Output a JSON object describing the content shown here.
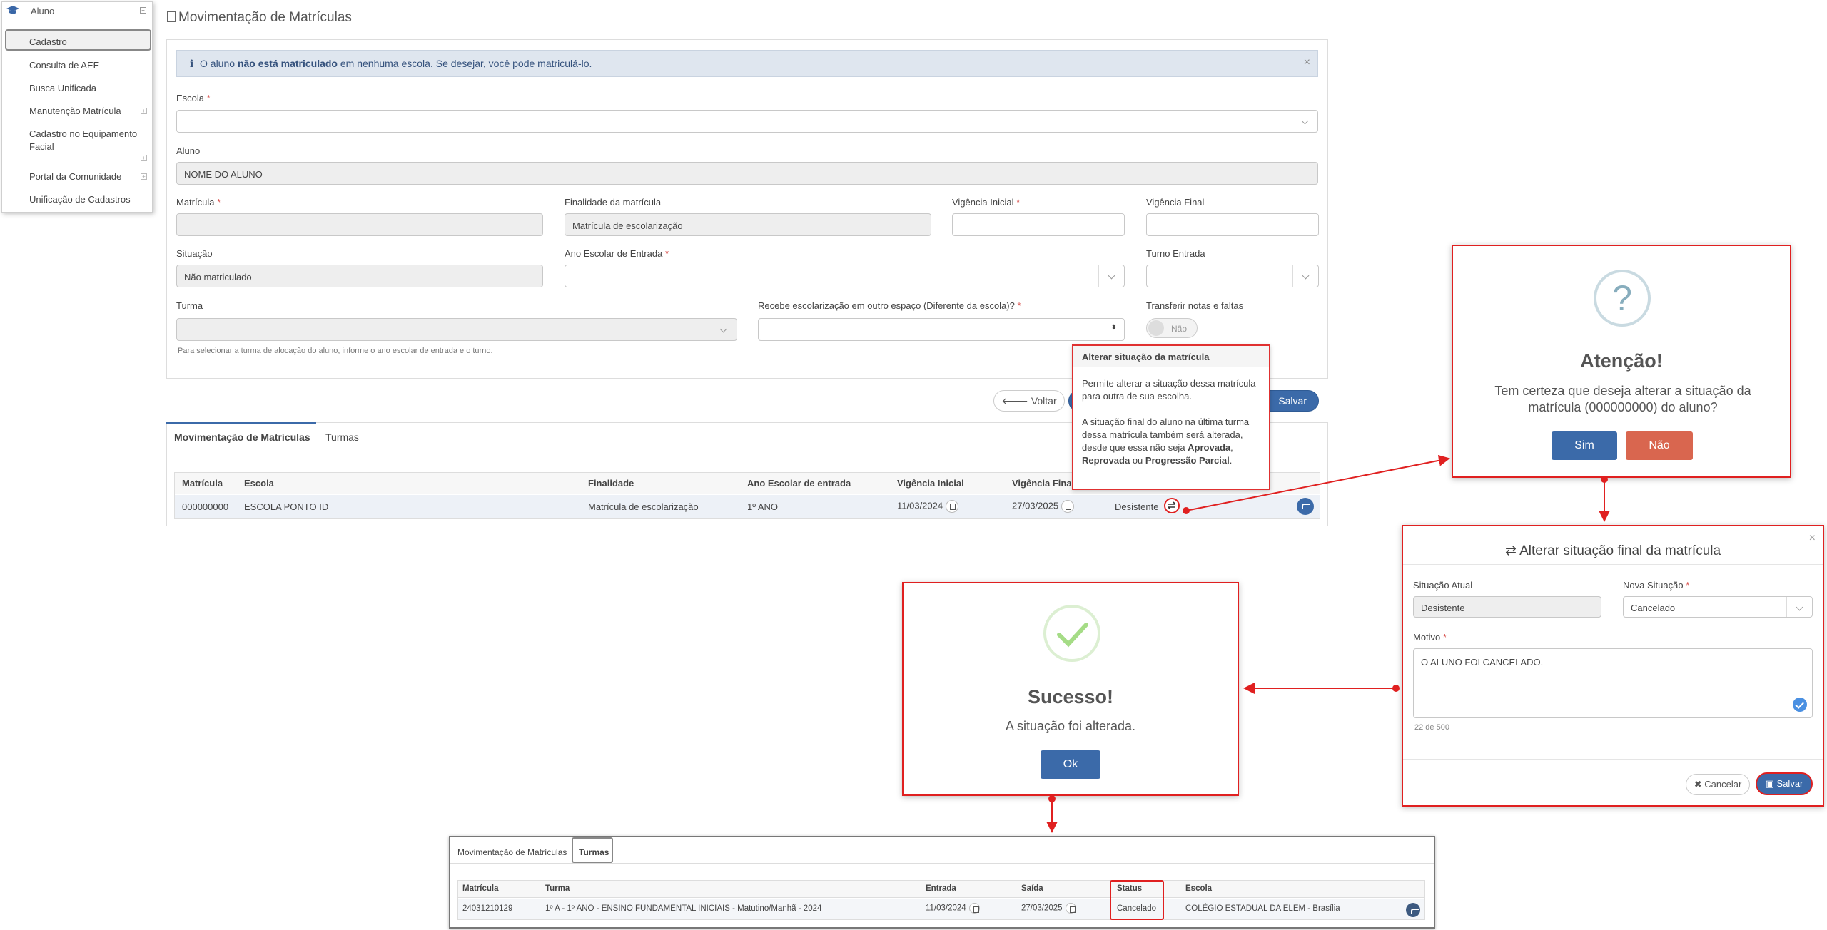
{
  "menu": {
    "header": "Aluno",
    "items": [
      "Cadastro",
      "Consulta de AEE",
      "Busca Unificada",
      "Manutenção Matrícula",
      "Cadastro no Equipamento",
      "Facial",
      "Portal da Comunidade",
      "Unificação de Cadastros"
    ]
  },
  "page": {
    "title": "Movimentação de Matrículas"
  },
  "alert": {
    "prefix": "O aluno ",
    "bold": "não está matriculado",
    "suffix": " em nenhuma escola. Se desejar, você pode matriculá-lo."
  },
  "form": {
    "escola_label": "Escola",
    "aluno_label": "Aluno",
    "aluno_value": "NOME DO ALUNO",
    "matricula_label": "Matrícula",
    "finalidade_label": "Finalidade da matrícula",
    "finalidade_value": "Matrícula de escolarização",
    "vig_ini_label": "Vigência Inicial",
    "vig_fin_label": "Vigência Final",
    "situacao_label": "Situação",
    "situacao_value": "Não matriculado",
    "ano_label": "Ano Escolar de Entrada",
    "turno_label": "Turno Entrada",
    "turma_label": "Turma",
    "recebe_label": "Recebe escolarização em outro espaço (Diferente da escola)?",
    "transferir_label": "Transferir notas e faltas",
    "transferir_value": "Não",
    "hint": "Para selecionar a turma de alocação do aluno, informe o ano escolar de entrada e o turno.",
    "req": "*"
  },
  "buttons": {
    "voltar": "Voltar",
    "salvar": "Salvar"
  },
  "tabs": [
    "Movimentação de Matrículas",
    "Turmas"
  ],
  "table": {
    "headers": [
      "Matrícula",
      "Escola",
      "Finalidade",
      "Ano Escolar de entrada",
      "Vigência Inicial",
      "Vigência Final"
    ],
    "row": [
      "000000000",
      "ESCOLA PONTO ID",
      "Matrícula de escolarização",
      "1º ANO",
      "11/03/2024",
      "27/03/2025",
      "Desistente"
    ]
  },
  "tooltip": {
    "title": "Alterar situação da matrícula",
    "p1": "Permite alterar a situação dessa matrícula para outra de sua escolha.",
    "p2a": "A situação final do aluno na última turma dessa matrícula também será alterada, desde que essa não seja ",
    "b1": "Aprovada",
    "sep1": ", ",
    "b2": "Reprovada",
    "sep2": " ou ",
    "b3": "Progressão Parcial",
    "end": "."
  },
  "attention": {
    "icon": "?",
    "title": "Atenção!",
    "text": "Tem certeza que deseja alterar a situação da matrícula (000000000) do aluno?",
    "yes": "Sim",
    "no": "Não",
    "yes_color": "#3b6aa9",
    "no_color": "#d9664f"
  },
  "final_modal": {
    "title": "Alterar situação final da matrícula",
    "atual_label": "Situação Atual",
    "atual_value": "Desistente",
    "nova_label": "Nova Situação",
    "nova_value": "Cancelado",
    "motivo_label": "Motivo",
    "motivo_value": "O ALUNO FOI CANCELADO.",
    "counter": "22 de 500",
    "cancel": "Cancelar",
    "save": "Salvar",
    "close": "×"
  },
  "success": {
    "title": "Sucesso!",
    "text": "A situação foi alterada.",
    "ok": "Ok",
    "check_color": "#a5dc86"
  },
  "bottom": {
    "tabs": [
      "Movimentação de Matrículas",
      "Turmas"
    ],
    "headers": [
      "Matrícula",
      "Turma",
      "Entrada",
      "Saída",
      "Status",
      "Escola"
    ],
    "row": [
      "24031210129",
      "1º A - 1º ANO - ENSINO FUNDAMENTAL INICIAIS - Matutino/Manhã - 2024",
      "11/03/2024",
      "27/03/2025",
      "Cancelado",
      "COLÉGIO ESTADUAL DA ELEM - Brasília"
    ]
  },
  "colors": {
    "accent": "#3b6aa9",
    "highlight": "#e02020"
  }
}
